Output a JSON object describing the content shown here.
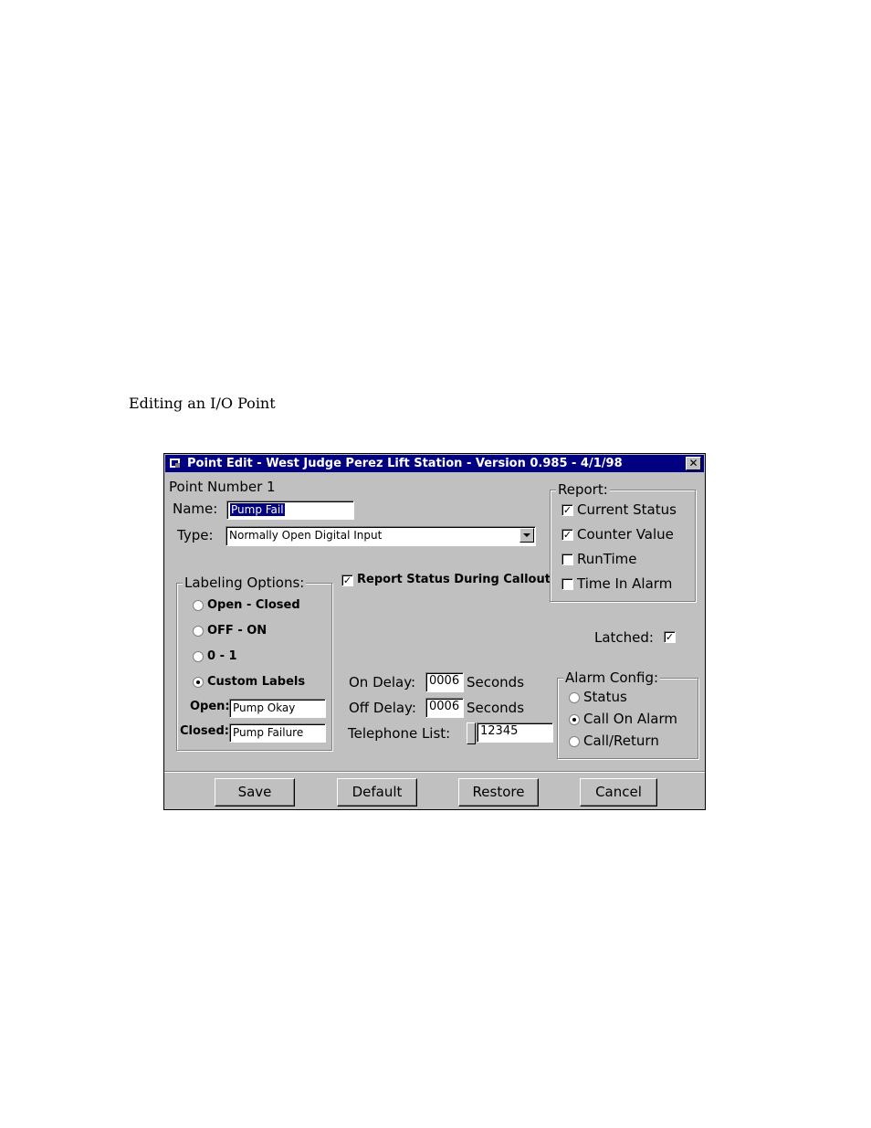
{
  "caption": "Editing an I/O Point",
  "window": {
    "title": "Point Edit - West Judge Perez Lift Station - Version 0.985 - 4/1/98",
    "close_glyph": "✕"
  },
  "point": {
    "number_label": "Point Number 1",
    "name_label": "Name:",
    "name_value": "Pump Fail",
    "type_label": "Type:",
    "type_value": "Normally Open Digital Input"
  },
  "labeling": {
    "title": "Labeling Options:",
    "options": [
      {
        "label": "Open - Closed",
        "selected": false
      },
      {
        "label": "OFF - ON",
        "selected": false
      },
      {
        "label": "0 - 1",
        "selected": false
      },
      {
        "label": "Custom Labels",
        "selected": true
      }
    ],
    "open_label": "Open:",
    "open_value": "Pump Okay",
    "closed_label": "Closed:",
    "closed_value": "Pump Failure"
  },
  "report_callout": {
    "label": "Report Status During Callout",
    "checked": true
  },
  "report": {
    "title": "Report:",
    "items": [
      {
        "label": "Current Status",
        "checked": true
      },
      {
        "label": "Counter Value",
        "checked": true
      },
      {
        "label": "RunTime",
        "checked": false
      },
      {
        "label": "Time In Alarm",
        "checked": false
      }
    ]
  },
  "latched": {
    "label": "Latched:",
    "checked": true
  },
  "delays": {
    "on_label": "On Delay:",
    "on_value": "0006",
    "off_label": "Off Delay:",
    "off_value": "0006",
    "unit": "Seconds",
    "telephone_label": "Telephone List:",
    "telephone_value": "12345"
  },
  "alarm": {
    "title": "Alarm Config:",
    "options": [
      {
        "label": "Status",
        "selected": false
      },
      {
        "label": "Call On Alarm",
        "selected": true
      },
      {
        "label": "Call/Return",
        "selected": false
      }
    ]
  },
  "buttons": {
    "save": "Save",
    "default": "Default",
    "restore": "Restore",
    "cancel": "Cancel"
  },
  "check_glyph": "✓"
}
